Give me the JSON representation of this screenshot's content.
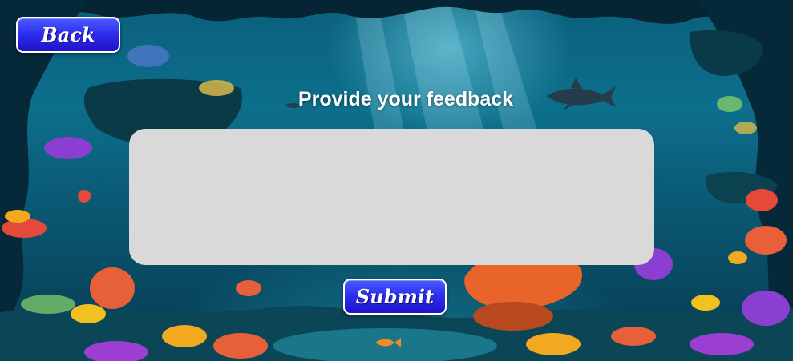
{
  "back_button": {
    "label": "Back"
  },
  "feedback": {
    "title": "Provide your feedback",
    "value": "",
    "placeholder": ""
  },
  "submit_button": {
    "label": "Submit"
  },
  "colors": {
    "button_blue": "#2f2ff0",
    "textarea_bg": "#d9d9d9",
    "water": "#0c6f8c",
    "text": "#ffffff"
  }
}
